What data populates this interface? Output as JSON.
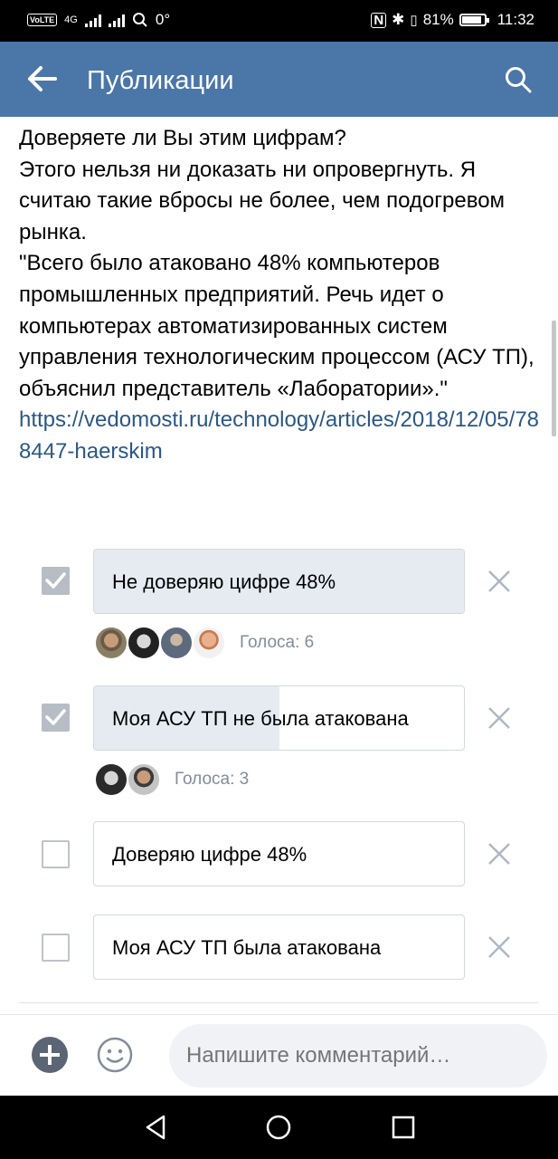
{
  "status_bar": {
    "left_network": "4G",
    "left_temp": "0°",
    "battery_percent": "81%",
    "time": "11:32"
  },
  "header": {
    "title": "Публикации",
    "back_icon": "arrow-left-icon",
    "search_icon": "search-icon",
    "color": "#4a76a8"
  },
  "post": {
    "lines": [
      "Доверяете ли Вы этим цифрам?",
      "Этого нельзя ни доказать ни опровергнуть. Я считаю такие вбросы не более, чем подогревом рынка.",
      "\"Всего было атаковано 48% компьютеров промышленных предприятий. Речь идет о компьютерах автоматизированных систем управления технологическим процессом (АСУ ТП), объяснил представитель «Лаборатории».\""
    ],
    "link": "https://vedomosti.ru/technology/articles/2018/12/05/788447-haerskim"
  },
  "poll": {
    "options": [
      {
        "label": "Не доверяю цифре 48%",
        "checked": true,
        "vote_share": 1.0,
        "votes_text": "Голоса: 6"
      },
      {
        "label": "Моя АСУ ТП не была атакована",
        "checked": true,
        "vote_share": 0.5,
        "votes_text": "Голоса: 3"
      },
      {
        "label": "Доверяю цифре 48%",
        "checked": false,
        "vote_share": 0
      },
      {
        "label": "Моя АСУ ТП была атакована",
        "checked": false,
        "vote_share": 0
      }
    ]
  },
  "comment_bar": {
    "placeholder": "Напишите комментарий…",
    "add_icon": "plus-circle-icon",
    "emoji_icon": "smile-icon"
  }
}
